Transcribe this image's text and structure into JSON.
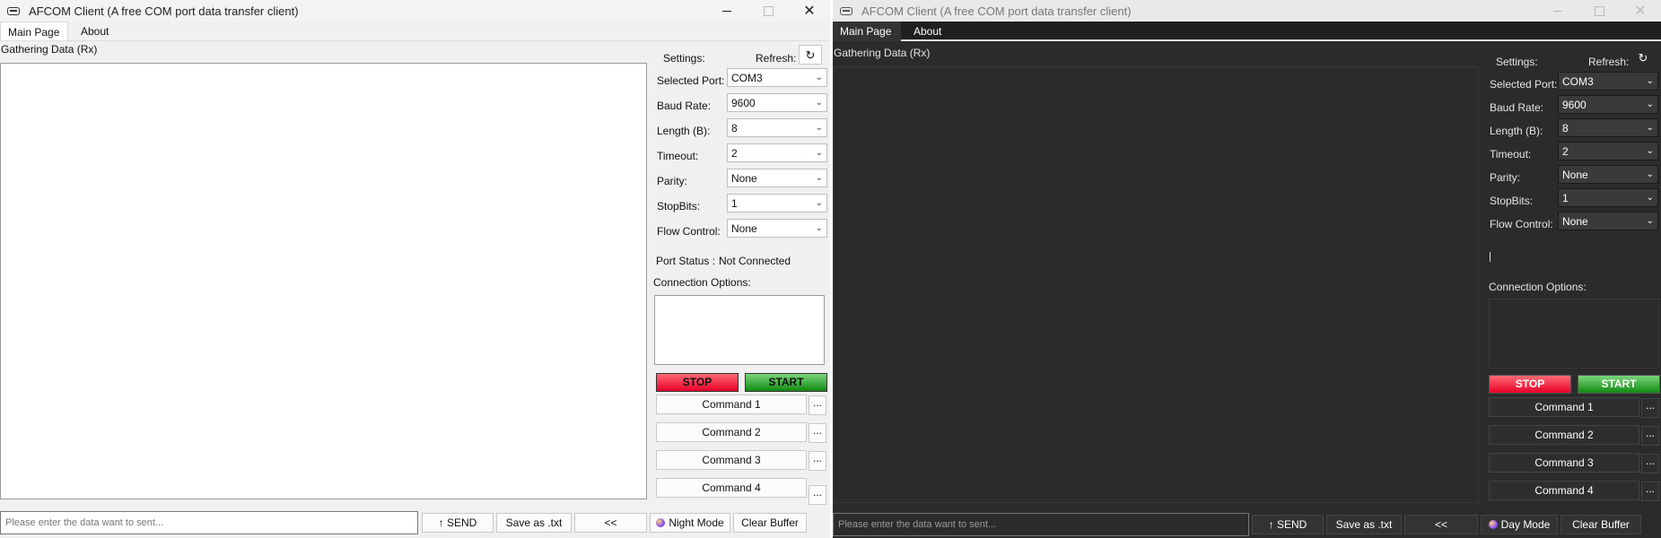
{
  "app": {
    "title": "AFCOM Client (A free COM port data transfer client)",
    "tabs": [
      "Main Page",
      "About"
    ],
    "rx_label": "Gathering Data (Rx)",
    "settings_label": "Settings:",
    "refresh_label": "Refresh:",
    "refresh_icon": "↻",
    "fields": [
      {
        "label": "Selected Port:",
        "value": "COM3"
      },
      {
        "label": "Baud Rate:",
        "value": "9600"
      },
      {
        "label": "Length (B):",
        "value": "8"
      },
      {
        "label": "Timeout:",
        "value": "2"
      },
      {
        "label": "Parity:",
        "value": "None"
      },
      {
        "label": "StopBits:",
        "value": "1"
      },
      {
        "label": "Flow Control:",
        "value": "None"
      }
    ],
    "port_status_label": "Port Status :",
    "port_status_value": "Not Connected",
    "connection_options_label": "Connection Options:",
    "stop_label": "STOP",
    "start_label": "START",
    "commands": [
      "Command 1",
      "Command 2",
      "Command 3",
      "Command 4"
    ],
    "more_label": "...",
    "input_placeholder": "Please enter the data want to sent...",
    "send_label": "↑ SEND",
    "save_label": "Save as .txt",
    "back_label": "<<",
    "clear_label": "Clear Buffer",
    "light_mode_toggle": "Night Mode",
    "dark_mode_toggle": "Day Mode",
    "dropdown_chevron": "⌄"
  },
  "colors": {
    "light_bg": "#f0f0f0",
    "dark_bg": "#2b2b2b",
    "stop_red": "#e8002a",
    "start_green": "#128a12"
  }
}
